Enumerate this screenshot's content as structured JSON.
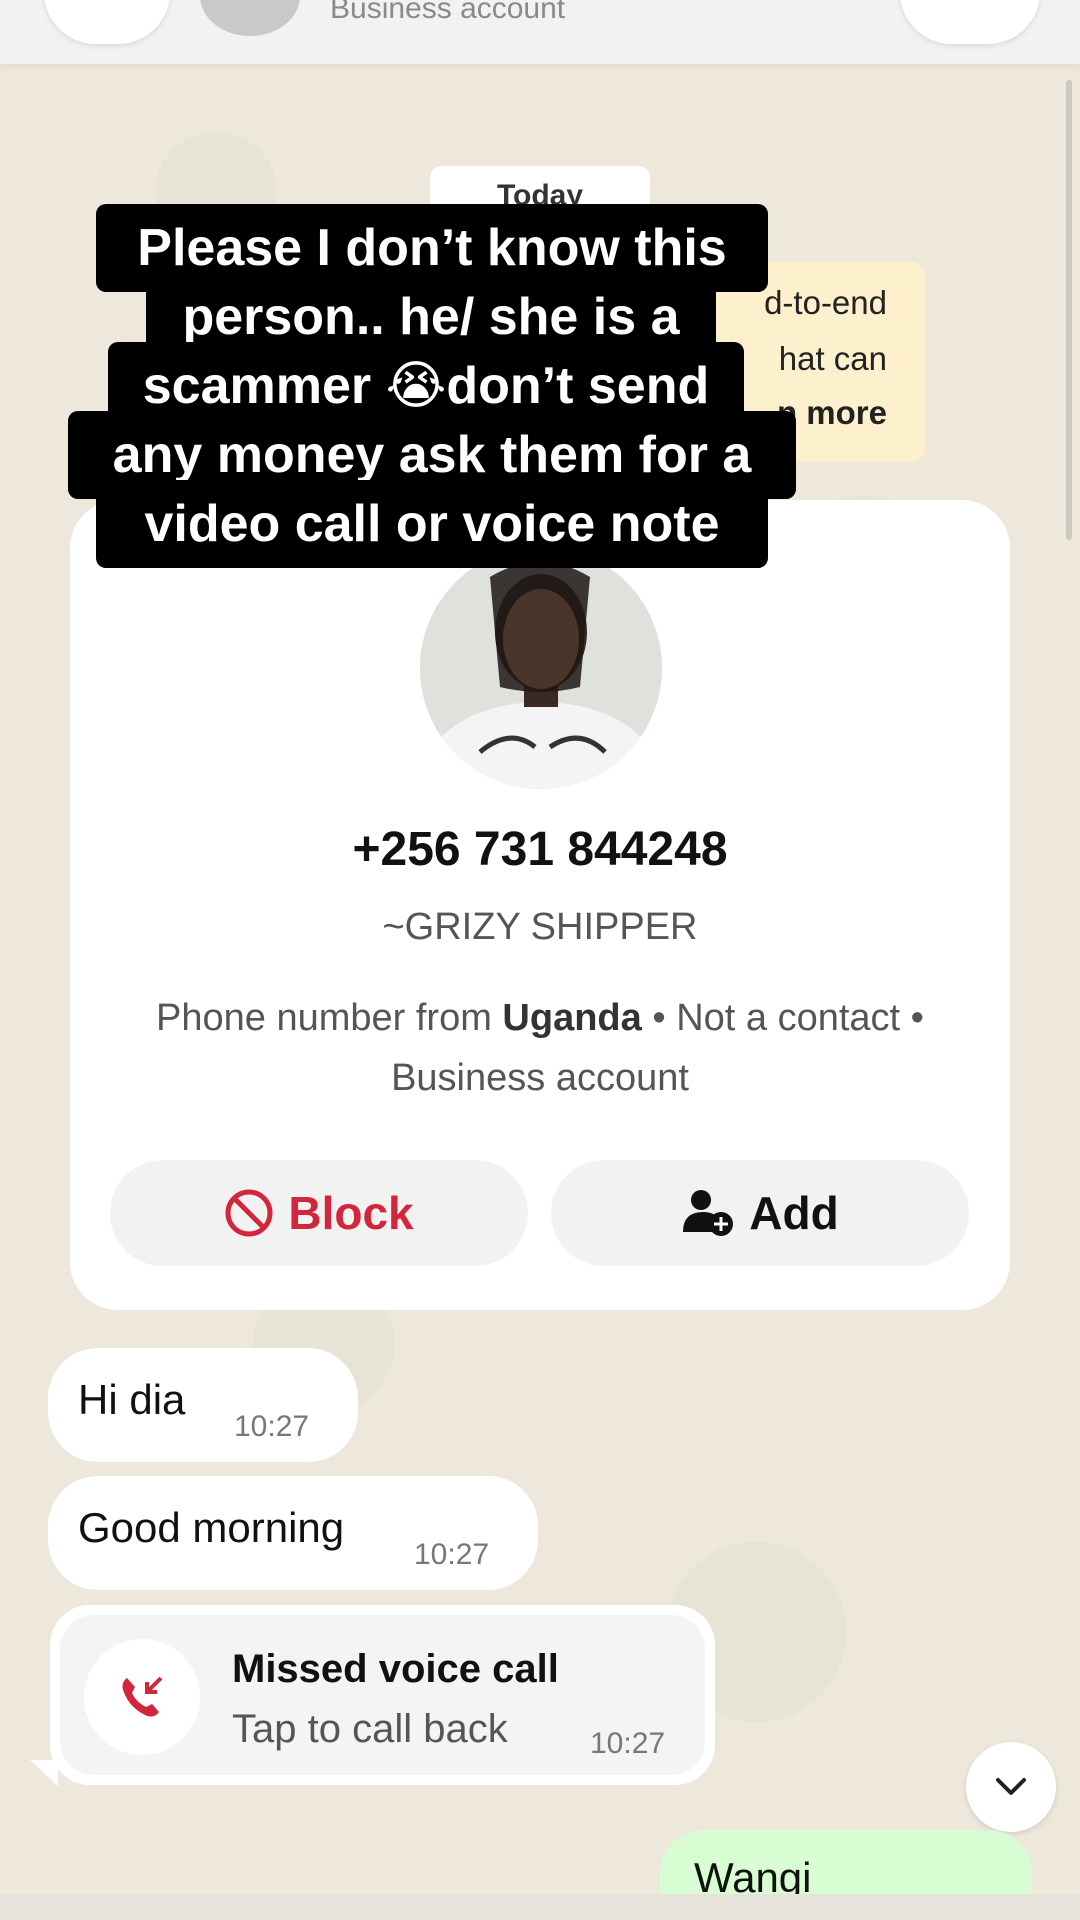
{
  "header": {
    "subtitle": "Business account"
  },
  "date_chip": "Today",
  "notice": {
    "line1": "d-to-end",
    "line2": "hat can",
    "line3": "n more"
  },
  "caption": {
    "lines": [
      "Please I don’t know this",
      "person.. he/ she is a",
      "scammer 😭don’t send",
      "any money ask them for a",
      "video call or voice note"
    ]
  },
  "profile": {
    "phone": "+256 731 844248",
    "push_name": "~GRIZY SHIPPER",
    "meta_prefix": "Phone number from ",
    "meta_country": "Uganda",
    "meta_suffix": " • Not a contact •",
    "meta_line2": "Business account",
    "block_label": "Block",
    "add_label": "Add"
  },
  "messages": [
    {
      "text": "Hi dia",
      "time": "10:27"
    },
    {
      "text": "Good morning",
      "time": "10:27"
    }
  ],
  "missed_call": {
    "title": "Missed voice call",
    "subtitle": "Tap to call back",
    "time": "10:27"
  },
  "outgoing": {
    "text": "Wangi"
  },
  "colors": {
    "block_red": "#d1263b",
    "outgoing_green": "#d9fdd3",
    "notice_yellow": "#fdf0cc"
  }
}
